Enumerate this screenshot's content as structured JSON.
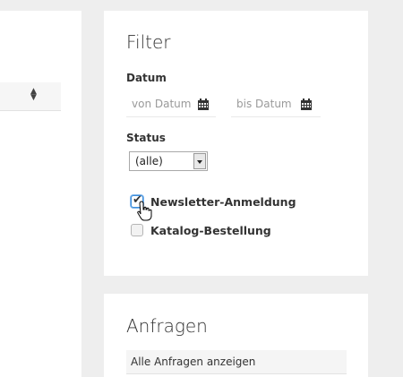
{
  "left_panel": {
    "sort_icon": "sort-icon"
  },
  "filter": {
    "title": "Filter",
    "date_label": "Datum",
    "from_placeholder": "von Datum",
    "to_placeholder": "bis Datum",
    "status_label": "Status",
    "status_selected": "(alle)",
    "checkboxes": [
      {
        "label": "Newsletter-Anmeldung",
        "checked": true
      },
      {
        "label": "Katalog-Bestellung",
        "checked": false
      }
    ]
  },
  "anfragen": {
    "title": "Anfragen",
    "link": "Alle Anfragen anzeigen"
  },
  "colors": {
    "background": "#eeeeee",
    "card": "#ffffff",
    "focus": "#3d8edc"
  }
}
